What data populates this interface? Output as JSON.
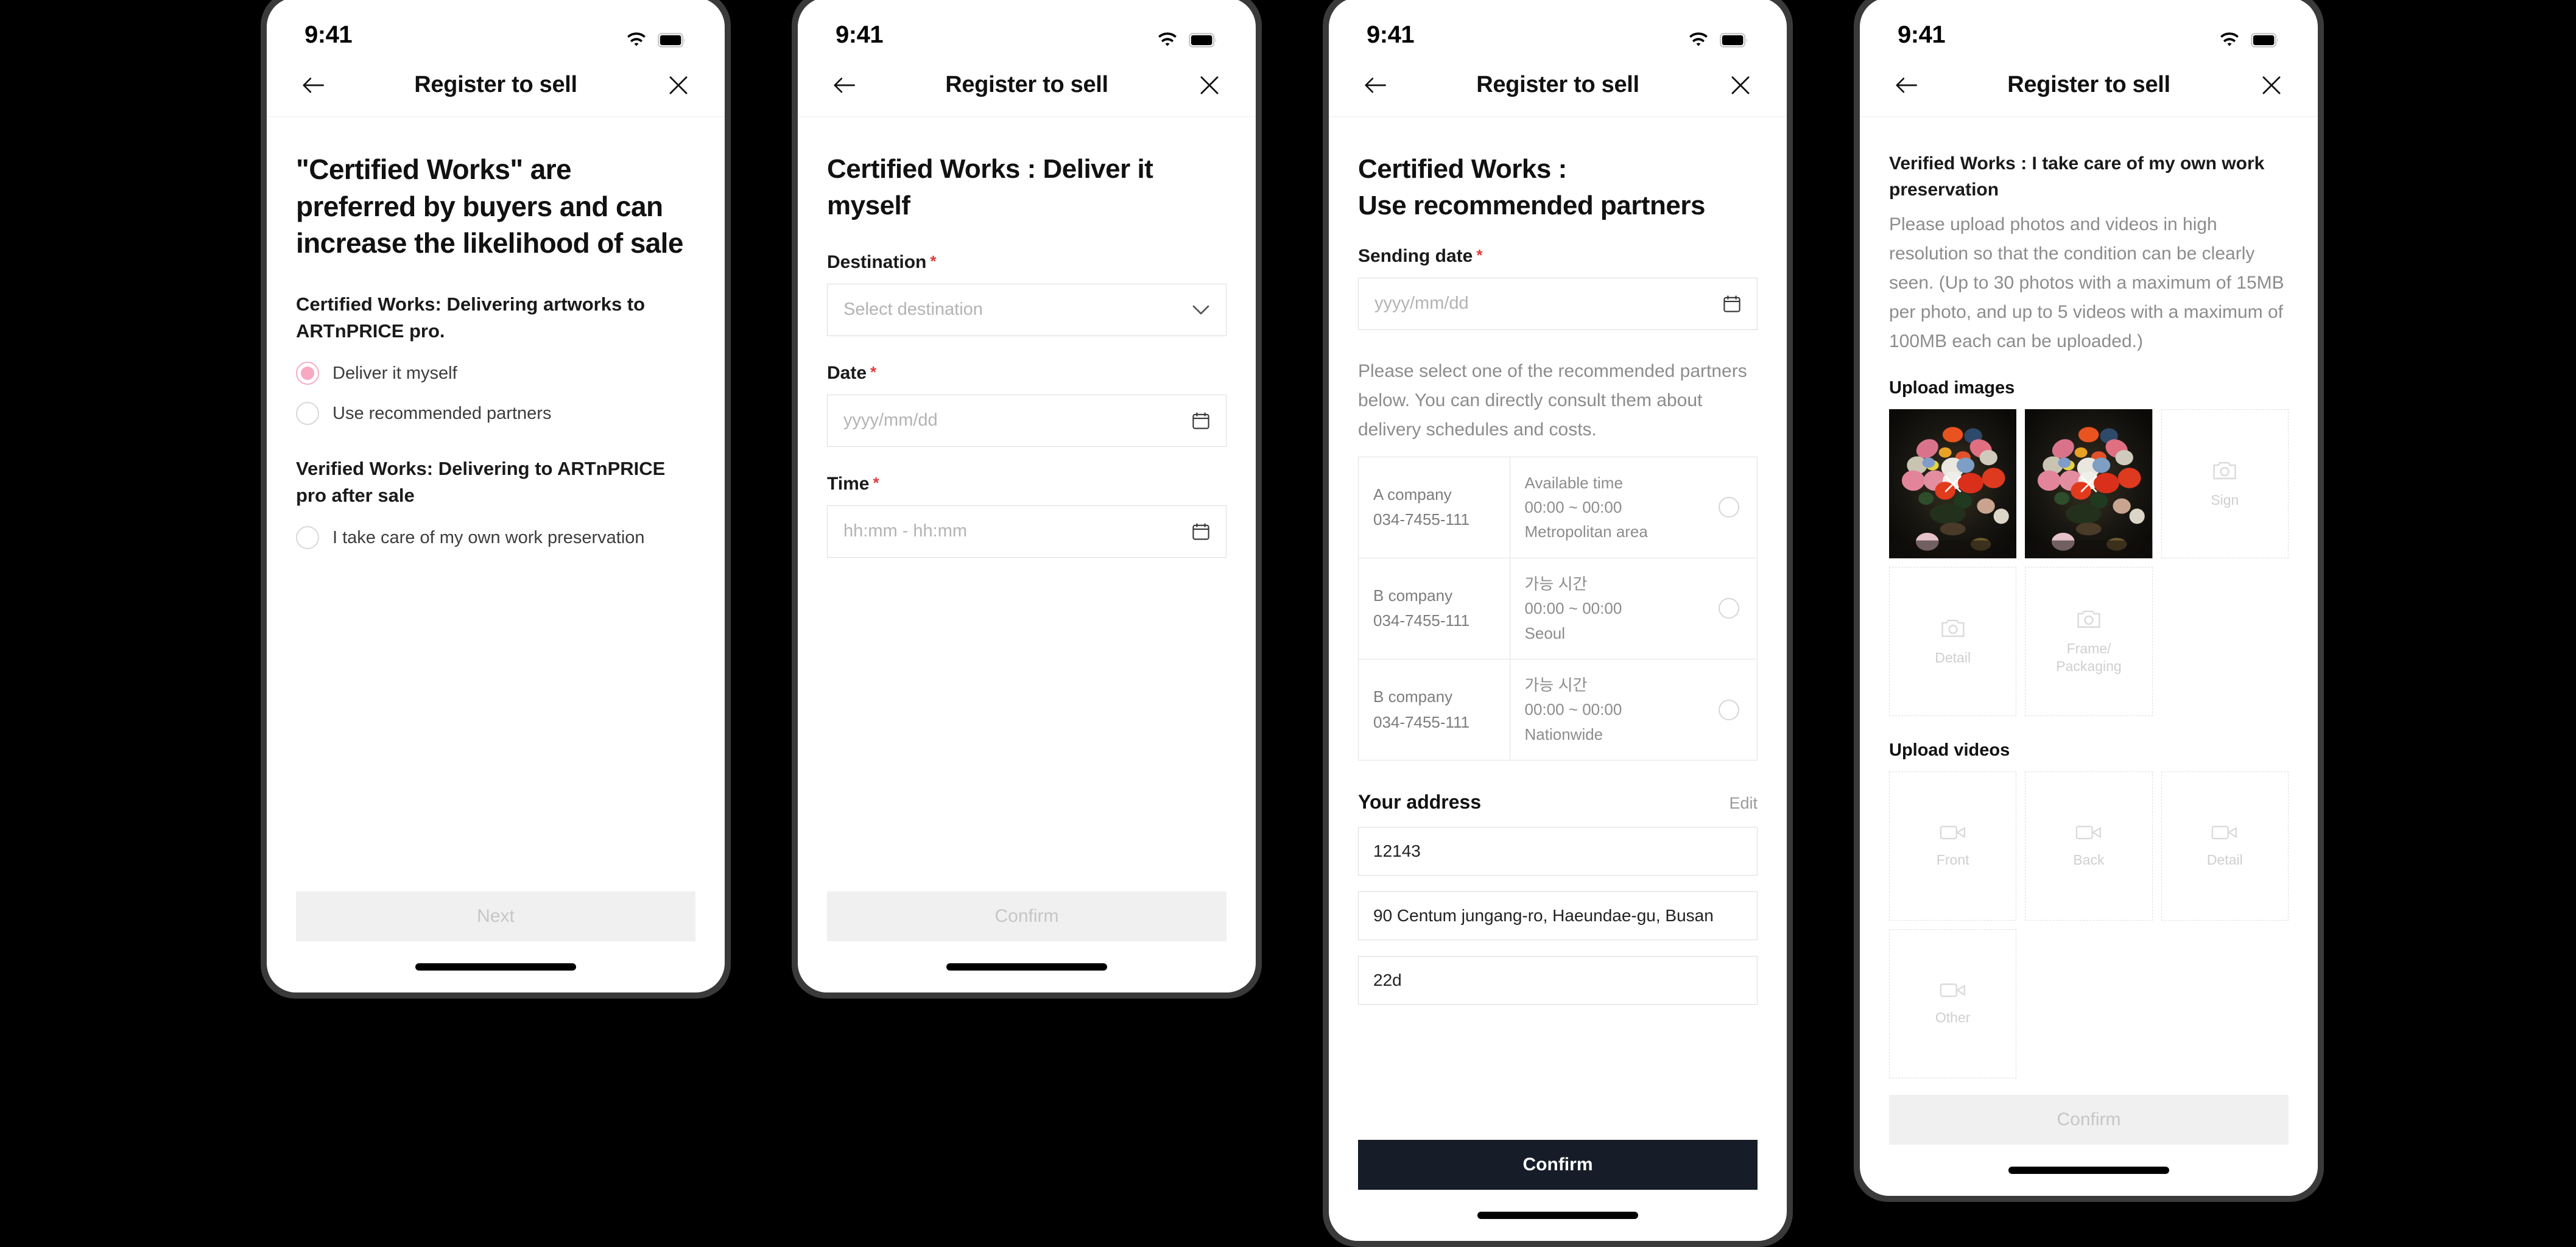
{
  "status_bar": {
    "time": "9:41",
    "wifi_icon": "wifi-icon",
    "battery_icon": "battery-full-icon"
  },
  "nav": {
    "title": "Register to sell",
    "back_icon": "arrow-left-icon",
    "close_icon": "close-icon"
  },
  "colors": {
    "accent_pink": "#f9a8c2",
    "primary_dark": "#161d28",
    "required_red": "#e23b3b",
    "disabled_bg": "#f0f0f0",
    "disabled_text": "#c6c6c6",
    "muted_text": "#8c8c8c",
    "border": "#dcdcdc",
    "device_frame": "#3a3a3a",
    "canvas": "#000000"
  },
  "screen1": {
    "heading": "\"Certified Works\" are preferred by buyers and can increase the likelihood of sale",
    "group1_label": "Certified Works: Delivering artworks to ARTnPRICE pro.",
    "group1_options": [
      {
        "label": "Deliver it myself",
        "selected": true
      },
      {
        "label": "Use recommended partners",
        "selected": false
      }
    ],
    "group2_label": "Verified Works: Delivering to ARTnPRICE pro after sale",
    "group2_options": [
      {
        "label": "I take care of my own work preservation",
        "selected": false
      }
    ],
    "cta": {
      "label": "Next",
      "enabled": false
    }
  },
  "screen2": {
    "heading": "Certified Works : Deliver it myself",
    "fields": [
      {
        "label": "Destination",
        "required": "*",
        "placeholder": "Select destination",
        "value": "",
        "icon": "chevron-down-icon"
      },
      {
        "label": "Date",
        "required": "*",
        "placeholder": "yyyy/mm/dd",
        "value": "",
        "icon": "calendar-icon"
      },
      {
        "label": "Time",
        "required": "*",
        "placeholder": "hh:mm - hh:mm",
        "value": "",
        "icon": "calendar-icon"
      }
    ],
    "cta": {
      "label": "Confirm",
      "enabled": false
    }
  },
  "screen3": {
    "heading_line1": "Certified Works :",
    "heading_line2": "Use recommended partners",
    "sending_date": {
      "label": "Sending date",
      "required": "*",
      "placeholder": "yyyy/mm/dd",
      "value": "",
      "icon": "calendar-icon"
    },
    "helper": "Please select one of the recommended partners below. You can directly consult them about delivery schedules and costs.",
    "partners": [
      {
        "name": "A company",
        "phone": "034-7455-111",
        "time_label": "Available time",
        "hours": "00:00 ~ 00:00",
        "area": "Metropolitan area",
        "selected": false
      },
      {
        "name": "B company",
        "phone": "034-7455-111",
        "time_label": "가능 시간",
        "hours": "00:00 ~ 00:00",
        "area": "Seoul",
        "selected": false
      },
      {
        "name": "B company",
        "phone": "034-7455-111",
        "time_label": "가능 시간",
        "hours": "00:00 ~ 00:00",
        "area": "Nationwide",
        "selected": false
      }
    ],
    "address": {
      "title": "Your address",
      "edit_label": "Edit",
      "postal_code": "12143",
      "street": "90 Centum jungang-ro, Haeundae-gu, Busan",
      "detail": "22d"
    },
    "cta": {
      "label": "Confirm",
      "enabled": true
    }
  },
  "screen4": {
    "heading": "Verified Works : I take care of my own work preservation",
    "helper": "Please upload photos and videos in high resolution so that the condition can be clearly seen. (Up to 30 photos with a maximum of 15MB per photo, and up to 5 videos with a maximum of 100MB each can be uploaded.)",
    "images_section": {
      "title": "Upload images"
    },
    "image_slots": [
      {
        "type": "photo",
        "label": "",
        "filled": true,
        "delete_icon": "close-icon"
      },
      {
        "type": "photo",
        "label": "",
        "filled": true,
        "delete_icon": "close-icon"
      },
      {
        "type": "placeholder",
        "label": "Sign",
        "filled": false,
        "icon": "camera-icon"
      },
      {
        "type": "placeholder",
        "label": "Detail",
        "filled": false,
        "icon": "camera-icon"
      },
      {
        "type": "placeholder",
        "label": "Frame/\nPackaging",
        "filled": false,
        "icon": "camera-icon"
      }
    ],
    "videos_section": {
      "title": "Upload videos"
    },
    "video_slots": [
      {
        "label": "Front",
        "icon": "video-camera-icon"
      },
      {
        "label": "Back",
        "icon": "video-camera-icon"
      },
      {
        "label": "Detail",
        "icon": "video-camera-icon"
      },
      {
        "label": "Other",
        "icon": "video-camera-icon"
      }
    ],
    "cta": {
      "label": "Confirm",
      "enabled": false
    }
  }
}
